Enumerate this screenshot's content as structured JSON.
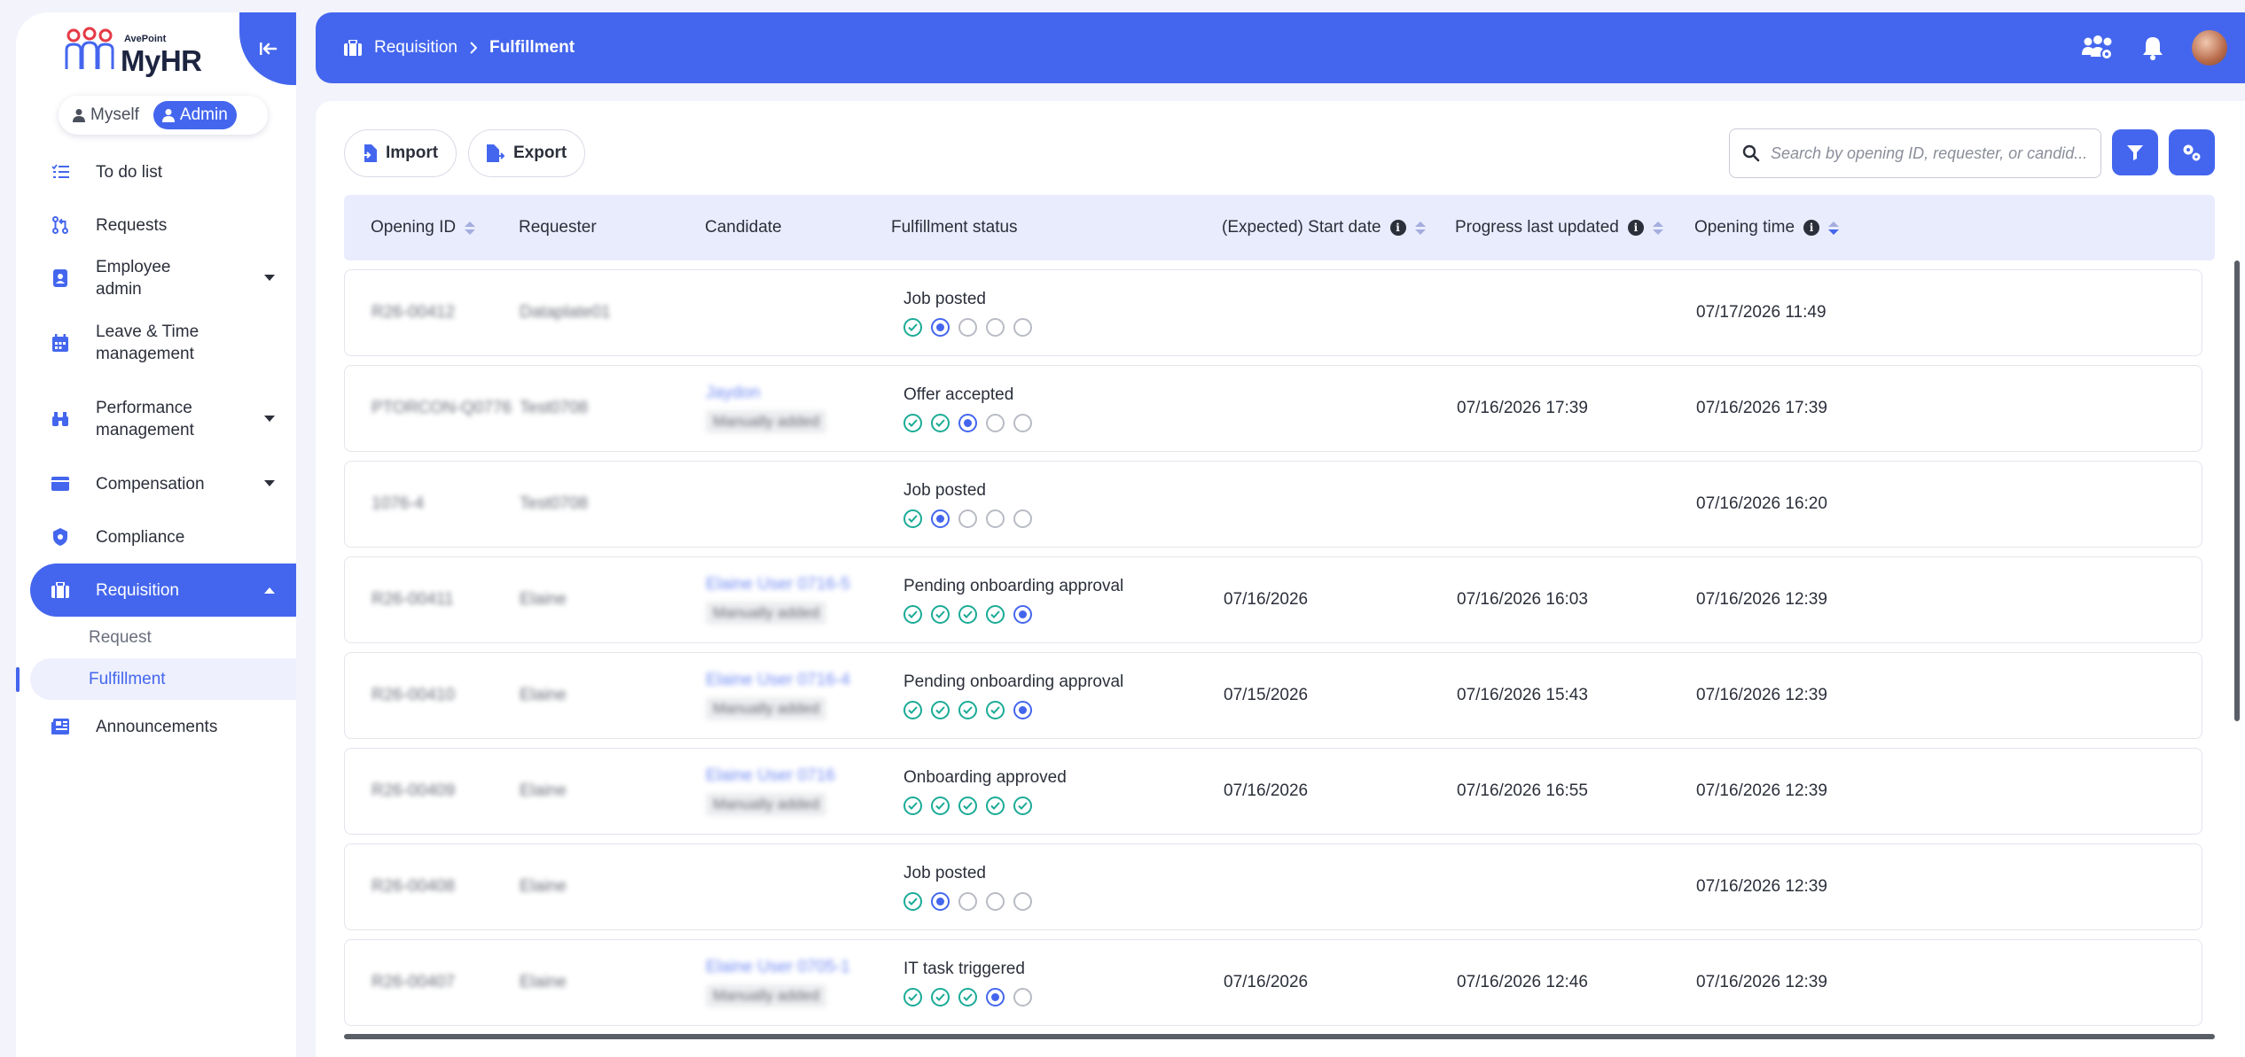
{
  "app": {
    "brand": "AvePoint",
    "title": "MyHR"
  },
  "roles": [
    {
      "label": "Myself",
      "active": false
    },
    {
      "label": "Admin",
      "active": true
    }
  ],
  "sidebar": {
    "items": [
      {
        "label": "To do list"
      },
      {
        "label": "Requests"
      },
      {
        "label": "Employee admin"
      },
      {
        "label": "Leave & Time management"
      },
      {
        "label": "Performance management"
      },
      {
        "label": "Compensation"
      },
      {
        "label": "Compliance"
      },
      {
        "label": "Requisition"
      },
      {
        "label": "Announcements"
      }
    ],
    "sub_items": [
      {
        "label": "Request"
      },
      {
        "label": "Fulfillment"
      }
    ]
  },
  "header": {
    "breadcrumb": [
      "Requisition",
      "Fulfillment"
    ]
  },
  "toolbar": {
    "import_label": "Import",
    "export_label": "Export"
  },
  "search": {
    "placeholder": "Search by opening ID, requester, or candid..."
  },
  "table": {
    "columns": [
      "Opening ID",
      "Requester",
      "Candidate",
      "Fulfillment status",
      "(Expected) Start date",
      "Progress last updated",
      "Opening time"
    ],
    "sort": {
      "column": "Opening time",
      "direction": "descending"
    },
    "rows": [
      {
        "opening_id": "R26-00412",
        "requester": "Dataplate01",
        "candidate": "",
        "candidate_tag": "",
        "status": "Job posted",
        "steps": [
          "done",
          "current",
          "todo",
          "todo",
          "todo"
        ],
        "start_date": "",
        "progress_updated": "",
        "opening_time": "07/17/2026 11:49"
      },
      {
        "opening_id": "PTORCON-Q0776",
        "requester": "Test0708",
        "candidate": "Jaydon",
        "candidate_tag": "Manually added",
        "status": "Offer accepted",
        "steps": [
          "done",
          "done",
          "current",
          "todo",
          "todo"
        ],
        "start_date": "",
        "progress_updated": "07/16/2026 17:39",
        "opening_time": "07/16/2026 17:39"
      },
      {
        "opening_id": "1076-4",
        "requester": "Test0708",
        "candidate": "",
        "candidate_tag": "",
        "status": "Job posted",
        "steps": [
          "done",
          "current",
          "todo",
          "todo",
          "todo"
        ],
        "start_date": "",
        "progress_updated": "",
        "opening_time": "07/16/2026 16:20"
      },
      {
        "opening_id": "R26-00411",
        "requester": "Elaine",
        "candidate": "Elaine User 0716-5",
        "candidate_tag": "Manually added",
        "status": "Pending onboarding approval",
        "steps": [
          "done",
          "done",
          "done",
          "done",
          "current"
        ],
        "start_date": "07/16/2026",
        "progress_updated": "07/16/2026 16:03",
        "opening_time": "07/16/2026 12:39"
      },
      {
        "opening_id": "R26-00410",
        "requester": "Elaine",
        "candidate": "Elaine User 0716-4",
        "candidate_tag": "Manually added",
        "status": "Pending onboarding approval",
        "steps": [
          "done",
          "done",
          "done",
          "done",
          "current"
        ],
        "start_date": "07/15/2026",
        "progress_updated": "07/16/2026 15:43",
        "opening_time": "07/16/2026 12:39"
      },
      {
        "opening_id": "R26-00409",
        "requester": "Elaine",
        "candidate": "Elaine User 0716",
        "candidate_tag": "Manually added",
        "status": "Onboarding approved",
        "steps": [
          "done",
          "done",
          "done",
          "done",
          "done"
        ],
        "start_date": "07/16/2026",
        "progress_updated": "07/16/2026 16:55",
        "opening_time": "07/16/2026 12:39"
      },
      {
        "opening_id": "R26-00408",
        "requester": "Elaine",
        "candidate": "",
        "candidate_tag": "",
        "status": "Job posted",
        "steps": [
          "done",
          "current",
          "todo",
          "todo",
          "todo"
        ],
        "start_date": "",
        "progress_updated": "",
        "opening_time": "07/16/2026 12:39"
      },
      {
        "opening_id": "R26-00407",
        "requester": "Elaine",
        "candidate": "Elaine User 0705-1",
        "candidate_tag": "Manually added",
        "status": "IT task triggered",
        "steps": [
          "done",
          "done",
          "done",
          "current",
          "todo"
        ],
        "start_date": "07/16/2026",
        "progress_updated": "07/16/2026 12:46",
        "opening_time": "07/16/2026 12:39"
      }
    ]
  },
  "colors": {
    "accent": "#4466ee",
    "done": "#1aab96",
    "pending": "#b8bbc4",
    "header_row": "#e9ecfd"
  }
}
